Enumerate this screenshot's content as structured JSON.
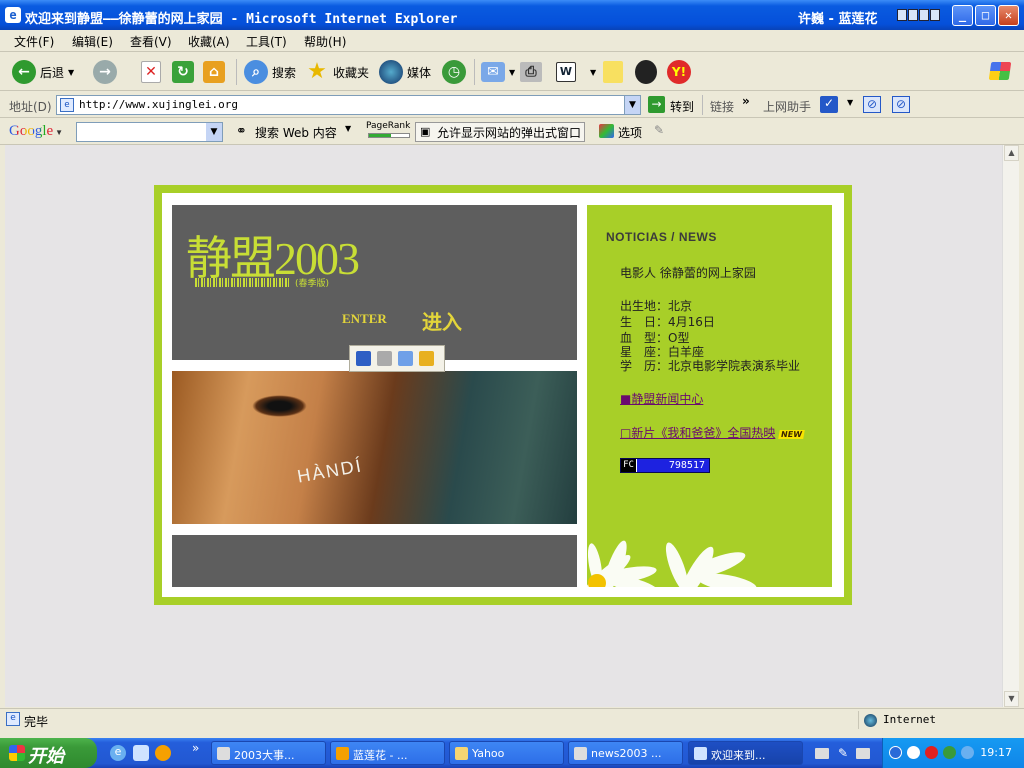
{
  "window": {
    "title": "欢迎来到静盟——徐静蕾的网上家园 - Microsoft Internet Explorer",
    "title_extra": "许巍 - 蓝莲花"
  },
  "menu": [
    "文件(F)",
    "编辑(E)",
    "查看(V)",
    "收藏(A)",
    "工具(T)",
    "帮助(H)"
  ],
  "toolbar": {
    "back": "后退",
    "search": "搜索",
    "favorites": "收藏夹",
    "media": "媒体"
  },
  "address": {
    "label": "地址(D)",
    "url": "http://www.xujinglei.org",
    "go": "转到",
    "links": "链接",
    "helper": "上网助手"
  },
  "google_bar": {
    "logo": "Google",
    "search_web": "搜索 Web 内容",
    "pagerank": "PageRank",
    "popup": "允许显示网站的弹出式窗口",
    "options": "选项"
  },
  "page": {
    "logo_text": "静盟2003",
    "logo_sub": "(春季版)",
    "enter_en": "ENTER",
    "enter_cn": "进入",
    "photo_text": "HÀNDÍ",
    "news_title": "NOTICIAS / NEWS",
    "intro": "电影人 徐静蕾的网上家园",
    "profile": [
      "出生地：北京",
      "生　日：4月16日",
      "血　型：O型",
      "星　座：白羊座",
      "学　历：北京电影学院表演系毕业"
    ],
    "news_center": "■静盟新闻中心",
    "new_film": "□新片《我和爸爸》全国热映",
    "new_tag": "NEW",
    "counter_label": "FC",
    "counter_value": "798517"
  },
  "status": {
    "text": "完毕",
    "zone": "Internet"
  },
  "taskbar": {
    "start": "开始",
    "tasks": [
      "2003大事...",
      "蓝莲花 - ...",
      "Yahoo",
      "news2003 ...",
      "欢迎来到..."
    ],
    "clock": "19:17"
  }
}
